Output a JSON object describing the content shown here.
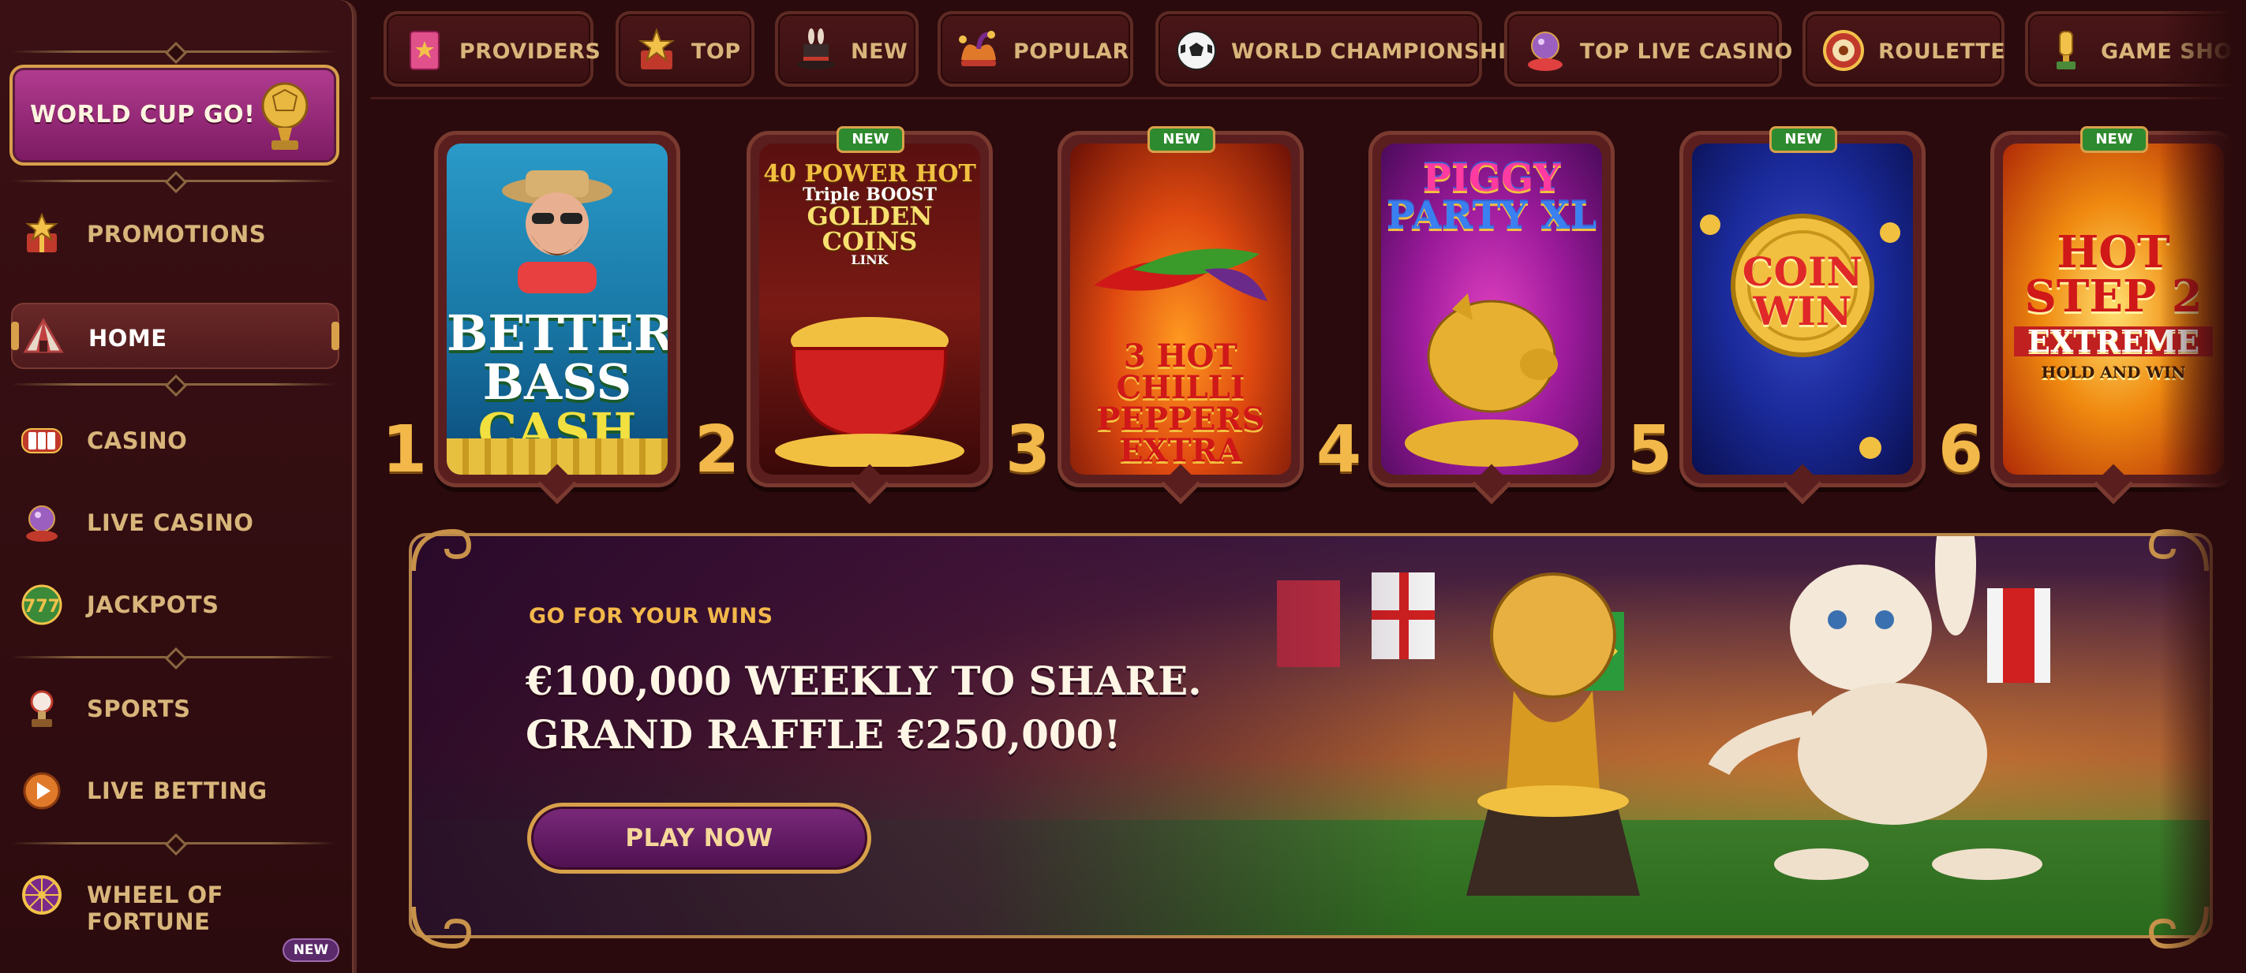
{
  "sidebar": {
    "featured": {
      "label": "WORLD CUP GO!",
      "icon": "golden-ball-trophy-icon"
    },
    "items": [
      {
        "label": "PROMOTIONS",
        "icon": "gift-star-icon"
      },
      {
        "label": "HOME",
        "icon": "tent-icon",
        "active": true
      },
      {
        "label": "CASINO",
        "icon": "slot-reels-icon"
      },
      {
        "label": "LIVE CASINO",
        "icon": "crystal-ball-icon"
      },
      {
        "label": "JACKPOTS",
        "icon": "jackpot-777-icon"
      },
      {
        "label": "SPORTS",
        "icon": "sports-trophy-icon"
      },
      {
        "label": "LIVE BETTING",
        "icon": "play-circle-icon"
      },
      {
        "label": "WHEEL OF FORTUNE",
        "icon": "fortune-wheel-icon"
      }
    ],
    "new_badge": "NEW"
  },
  "topnav": {
    "tabs": [
      {
        "label": "PROVIDERS",
        "icon": "book-icon"
      },
      {
        "label": "TOP",
        "icon": "star-box-icon"
      },
      {
        "label": "NEW",
        "icon": "magic-hat-icon"
      },
      {
        "label": "POPULAR",
        "icon": "jester-hat-icon"
      },
      {
        "label": "WORLD CHAMPIONSHIP",
        "icon": "soccer-ball-icon"
      },
      {
        "label": "TOP LIVE CASINO",
        "icon": "crystal-ball-icon"
      },
      {
        "label": "ROULETTE",
        "icon": "roulette-icon"
      },
      {
        "label": "GAME SHOW",
        "icon": "trophy-cup-icon"
      }
    ]
  },
  "games": [
    {
      "rank": "1",
      "title_lines": [
        "BETTER",
        "BASS",
        "CASH"
      ],
      "is_new": false
    },
    {
      "rank": "2",
      "title_lines": [
        "40 POWER HOT",
        "Triple BOOST",
        "GOLDEN COINS",
        "LINK"
      ],
      "is_new": true,
      "new_label": "NEW"
    },
    {
      "rank": "3",
      "title_lines": [
        "3 HOT CHILLI",
        "PEPPERS",
        "EXTRA"
      ],
      "is_new": true,
      "new_label": "NEW"
    },
    {
      "rank": "4",
      "title_lines": [
        "PIGGY",
        "PARTY XL"
      ],
      "is_new": false
    },
    {
      "rank": "5",
      "title_lines": [
        "COIN",
        "WIN"
      ],
      "is_new": true,
      "new_label": "NEW"
    },
    {
      "rank": "6",
      "title_lines": [
        "HOT STEP 2",
        "EXTREME",
        "HOLD AND WIN"
      ],
      "is_new": true,
      "new_label": "NEW"
    }
  ],
  "banner": {
    "eyebrow": "GO FOR YOUR WINS",
    "headline_1": "€100,000 WEEKLY TO SHARE.",
    "headline_2": "GRAND RAFFLE €250,000!",
    "cta": "PLAY NOW"
  },
  "colors": {
    "background": "#2a0a0c",
    "gold": "#d8a04a",
    "text_gold": "#d8b57a",
    "featured_pink": "#b23c90",
    "new_green": "#2e8a2e"
  }
}
